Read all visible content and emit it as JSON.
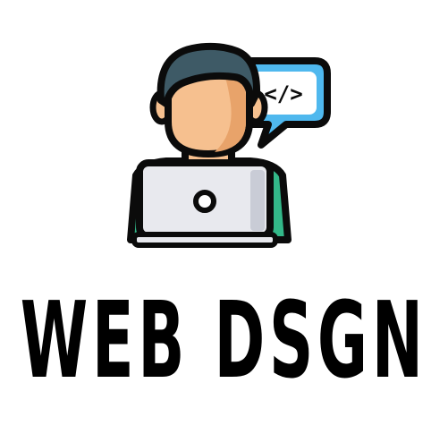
{
  "brand": {
    "wordmark": "WEB DSGN",
    "code_symbol": "</>"
  },
  "icons": {
    "illustration": "developer-at-laptop-icon",
    "speech_bubble": "code-speech-bubble-icon"
  },
  "colors": {
    "outline": "#0b0b0b",
    "skin": "#f6c08f",
    "skin_shade": "#e8a36a",
    "hair": "#3e5a66",
    "shirt": "#33b889",
    "laptop": "#e8e9ee",
    "laptop_shade": "#c9ccd6",
    "bubble": "#4fb8ee",
    "bubble_inner": "#ffffff",
    "text": "#000000"
  }
}
